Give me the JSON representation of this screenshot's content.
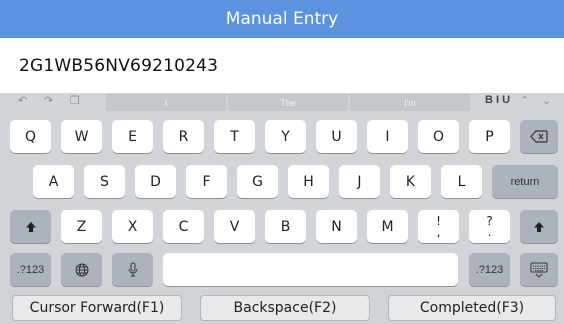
{
  "header": {
    "title": "Manual Entry"
  },
  "entry": {
    "value": "2G1WB56NV69210243"
  },
  "toolbar": {
    "suggestions": [
      "I",
      "The",
      "I'm"
    ],
    "format_label": "B I U"
  },
  "keyboard": {
    "row1": [
      "Q",
      "W",
      "E",
      "R",
      "T",
      "Y",
      "U",
      "I",
      "O",
      "P"
    ],
    "row2": [
      "A",
      "S",
      "D",
      "F",
      "G",
      "H",
      "J",
      "K",
      "L"
    ],
    "row3": [
      "Z",
      "X",
      "C",
      "V",
      "B",
      "N",
      "M"
    ],
    "return_label": "return",
    "numbers_label": ".?123",
    "punct1": {
      "top": "!",
      "bottom": ","
    },
    "punct2": {
      "top": "?",
      "bottom": "."
    }
  },
  "function_bar": {
    "cursor_forward": "Cursor Forward(F1)",
    "backspace": "Backspace(F2)",
    "completed": "Completed(F3)"
  }
}
